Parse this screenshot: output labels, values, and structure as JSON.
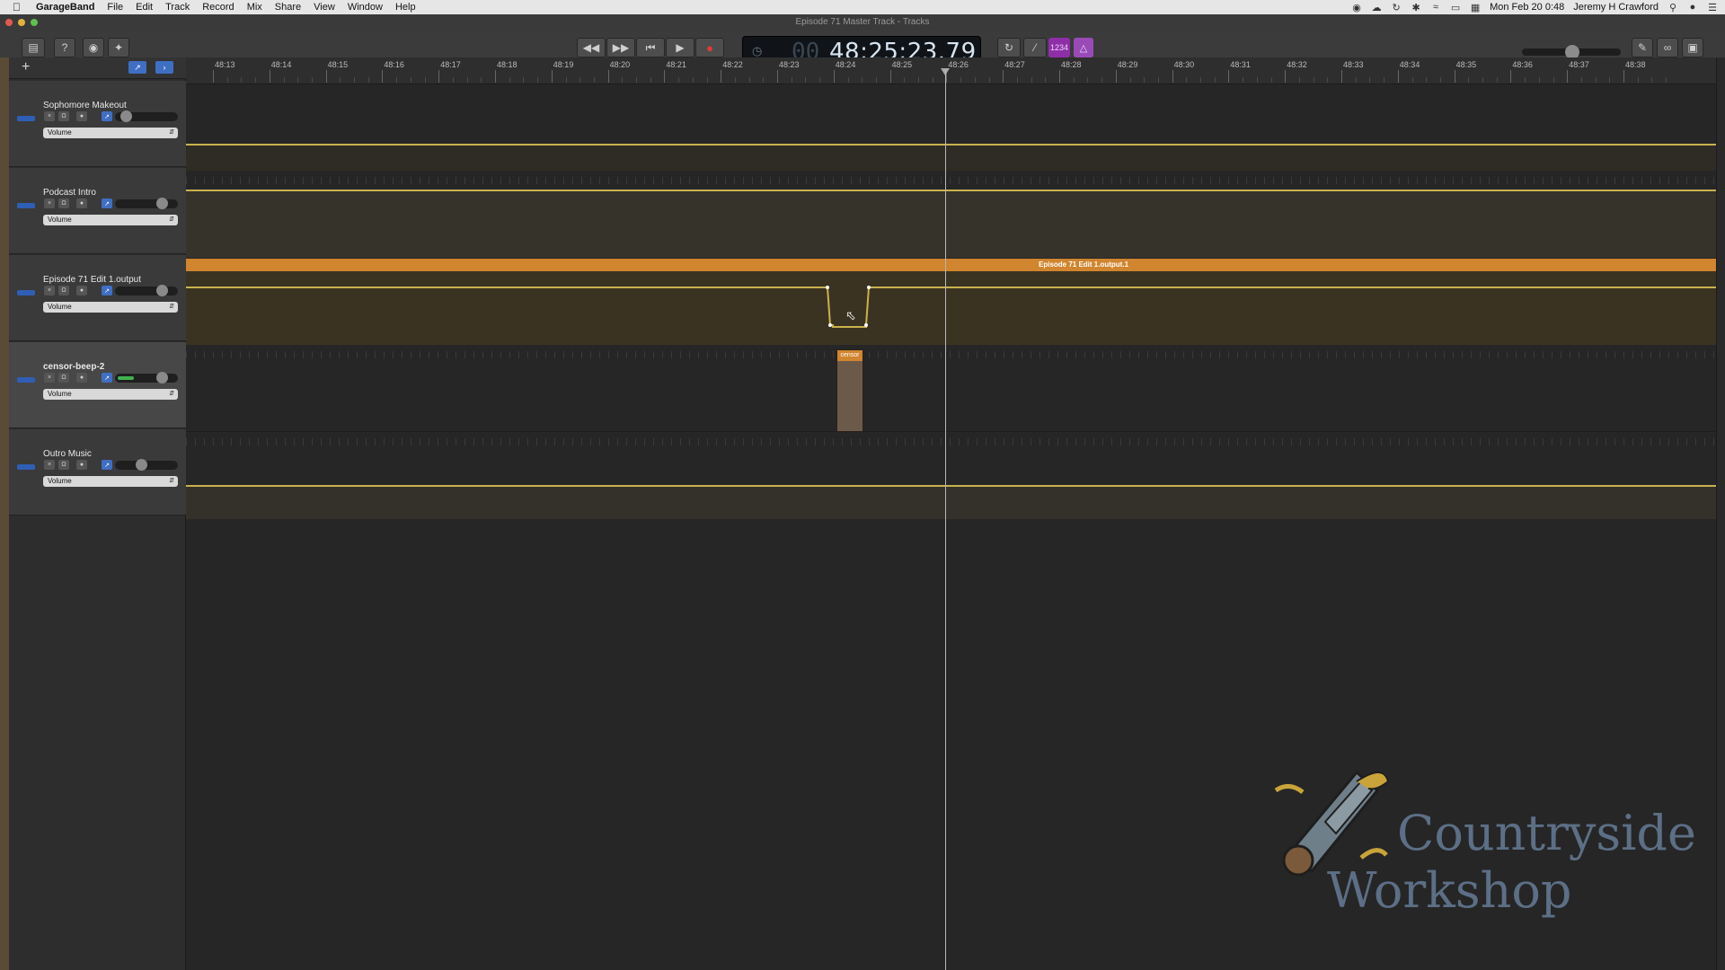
{
  "menubar": {
    "app_name": "GarageBand",
    "items": [
      "File",
      "Edit",
      "Track",
      "Record",
      "Mix",
      "Share",
      "View",
      "Window",
      "Help"
    ],
    "clock": "Mon Feb 20  0:48",
    "user": "Jeremy H Crawford"
  },
  "window": {
    "title": "Episode 71 Master Track - Tracks"
  },
  "transport": {
    "lcd_dim": "00",
    "lcd_time": "48:25:23.79",
    "count_in": "1234"
  },
  "ruler": {
    "labels": [
      "48:13",
      "48:14",
      "48:15",
      "48:16",
      "48:17",
      "48:18",
      "48:19",
      "48:20",
      "48:21",
      "48:22",
      "48:23",
      "48:24",
      "48:25",
      "48:26",
      "48:27",
      "48:28",
      "48:29",
      "48:30",
      "48:31",
      "48:32",
      "48:33",
      "48:34",
      "48:35",
      "48:36",
      "48:37",
      "48:38"
    ]
  },
  "tracks": [
    {
      "name": "Sophomore Makeout",
      "automation": "Volume",
      "volume": 0.1
    },
    {
      "name": "Podcast Intro",
      "automation": "Volume",
      "volume": 0.8
    },
    {
      "name": "Episode 71 Edit 1.output",
      "automation": "Volume",
      "volume": 0.8
    },
    {
      "name": "censor-beep-2",
      "automation": "Volume",
      "volume": 0.8
    },
    {
      "name": "Outro Music",
      "automation": "Volume",
      "volume": 0.4
    }
  ],
  "regions": {
    "episode_title": "Episode 71 Edit 1.output.1",
    "censor_label": "censor"
  },
  "watermark": {
    "line1": "Countryside",
    "line2": "Workshop"
  },
  "colors": {
    "region_orange": "#d0852e",
    "automation_line": "#c9b24e",
    "track_icon_blue": "#2f5fb5"
  }
}
